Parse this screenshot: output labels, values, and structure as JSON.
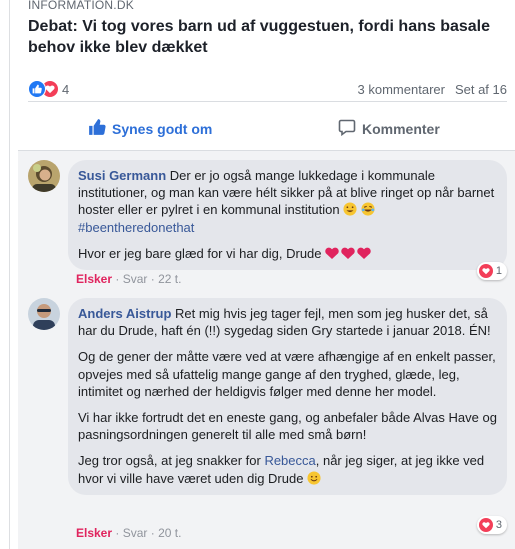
{
  "post": {
    "domain": "INFORMATION.DK",
    "headline": "Debat: Vi tog vores barn ud af vuggestuen, fordi hans basale behov ikke blev dækket"
  },
  "stats": {
    "reaction_count": "4",
    "comments": "3 kommentarer",
    "views": "Set af 16"
  },
  "actions": {
    "like_label": "Synes godt om",
    "comment_label": "Kommenter"
  },
  "comments": [
    {
      "author": "Susi Germann",
      "text1": "Der er jo også mange lukkedage i kommunale institutioner, og man kan være hélt sikker på at blive ringet op når barnet hoster eller er pylret i en kommunal institution",
      "hashtag": "#beentheredonethat",
      "text2": "Hvor er jeg bare glæd for vi har dig, Drude",
      "reaction": "Elsker",
      "reply": "Svar",
      "time": "22 t.",
      "react_count": "1"
    },
    {
      "author": "Anders Aistrup",
      "p1": "Ret mig hvis jeg tager fejl, men som jeg husker det, så har du Drude, haft én (!!) sygedag siden Gry startede i januar 2018. ÉN!",
      "p2": "Og de gener der måtte være ved at være afhængige af en enkelt passer, opvejes med så ufattelig mange gange af den tryghed, glæde, leg, intimitet og nærhed der heldigvis følger med denne her model.",
      "p3": "Vi har ikke fortrudt det en eneste gang, og anbefaler både Alvas Have og pasningsordningen generelt til alle med små børn!",
      "p4_before": "Jeg tror også, at jeg snakker for",
      "p4_mention": "Rebecca",
      "p4_after": ", når jeg siger, at jeg ikke ved hvor vi ville have været uden dig Drude",
      "reaction": "Elsker",
      "reply": "Svar",
      "time": "20 t.",
      "react_count": "3"
    }
  ],
  "colors": {
    "link_blue": "#385898",
    "like_blue": "#2d6fd8",
    "love_red": "#f33e58",
    "bubble_gray": "#e4e6eb"
  }
}
